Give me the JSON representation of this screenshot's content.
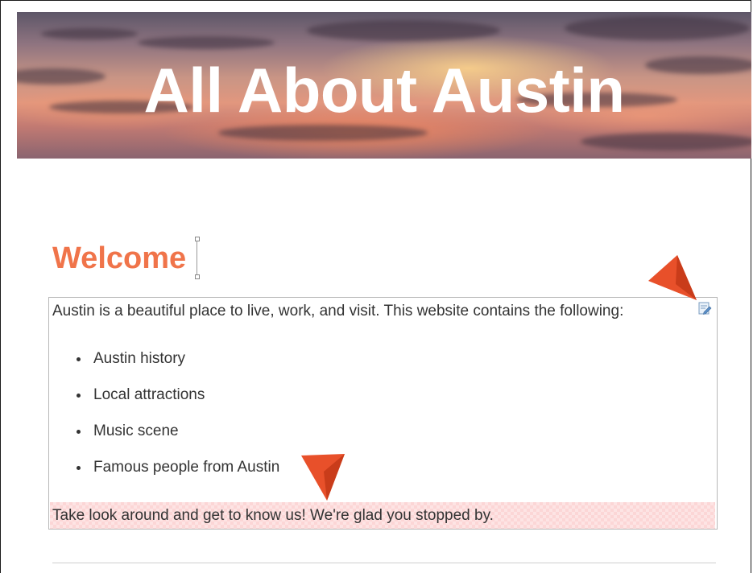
{
  "banner": {
    "title": "All About Austin"
  },
  "main": {
    "heading": "Welcome",
    "intro": "Austin is a beautiful place to live, work, and visit. This website contains the following:",
    "list_items": [
      "Austin history",
      "Local attractions",
      "Music scene",
      "Famous people from Austin"
    ],
    "closing": "Take look around and get to know us! We're glad you stopped by."
  },
  "icons": {
    "edit": "edit-paragraph-icon",
    "pointer": "orange-arrow-pointer"
  },
  "colors": {
    "heading": "#f0744a",
    "pointer": "#e8502a",
    "highlight": "#fcd6d6",
    "body_text": "#333333"
  }
}
